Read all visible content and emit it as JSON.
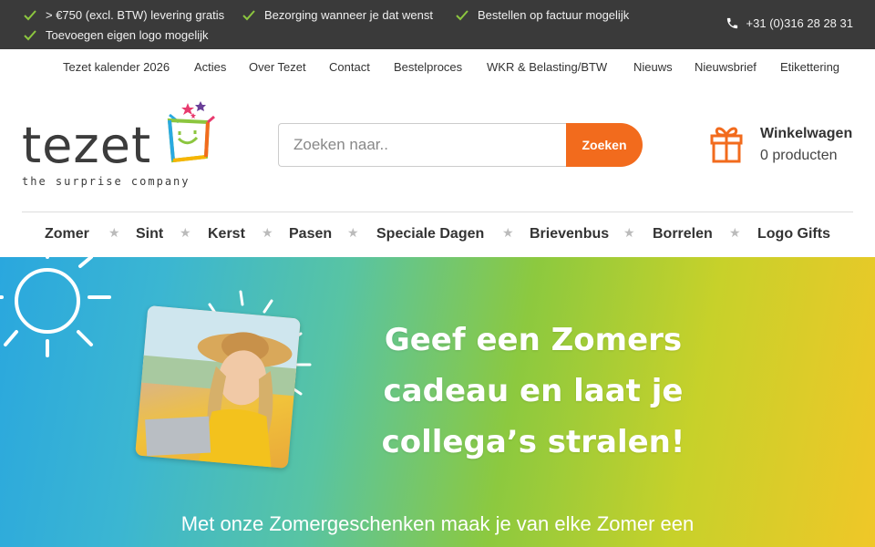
{
  "usp_bar": {
    "items": [
      "> €750 (excl. BTW) levering gratis",
      "Bezorging wanneer je dat wenst",
      "Bestellen op factuur mogelijk",
      "Toevoegen eigen logo mogelijk"
    ],
    "phone": "+31 (0)316 28 28 31",
    "check_color": "#8cc63f"
  },
  "topnav": {
    "items": [
      "Tezet kalender 2026",
      "Acties",
      "Over Tezet",
      "Contact",
      "Bestelproces",
      "WKR & Belasting/BTW",
      "Nieuws",
      "Nieuwsbrief",
      "Etikettering"
    ]
  },
  "logo": {
    "word": "tezet",
    "tagline": "the surprise company"
  },
  "search": {
    "placeholder": "Zoeken naar..",
    "button_label": "Zoeken",
    "accent": "#f26b1d"
  },
  "cart": {
    "title": "Winkelwagen",
    "count": "0 producten",
    "icon": "gift-icon"
  },
  "mainnav": {
    "items": [
      "Zomer",
      "Sint",
      "Kerst",
      "Pasen",
      "Speciale Dagen",
      "Brievenbus",
      "Borrelen",
      "Logo Gifts"
    ],
    "separator": "★"
  },
  "hero": {
    "title_lines": [
      "Geef een Zomers",
      "cadeau en laat je",
      "collega’s stralen!"
    ],
    "subtitle": "Met onze Zomergeschenken maak je van elke Zomer een"
  }
}
